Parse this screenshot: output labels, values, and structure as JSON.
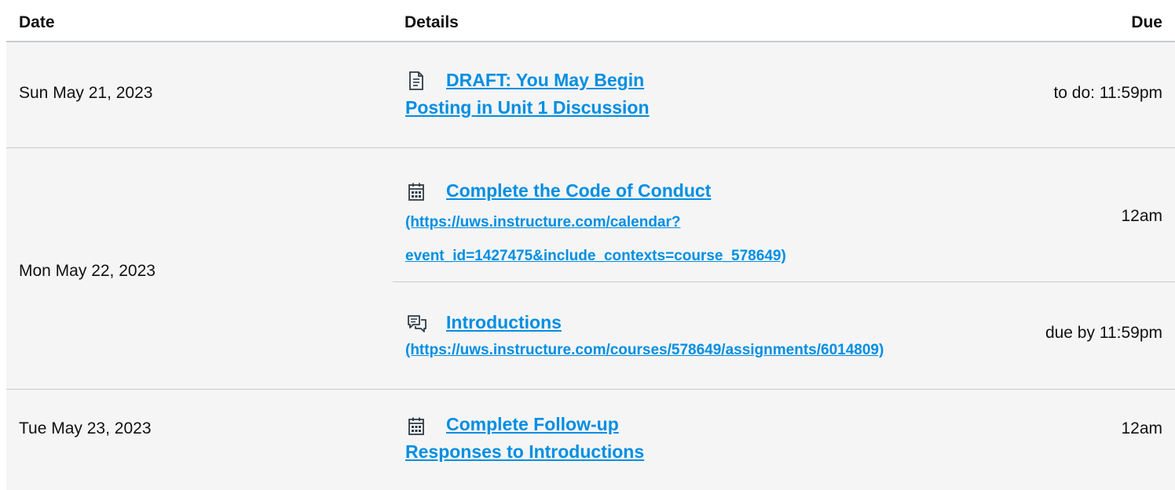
{
  "headers": {
    "date": "Date",
    "details": "Details",
    "due": "Due"
  },
  "rows": [
    {
      "date": "Sun May 21, 2023",
      "items": [
        {
          "icon": "document-icon",
          "title_line1": "DRAFT: You May Begin",
          "title_line2": "Posting in Unit 1 Discussion",
          "due": "to do: 11:59pm"
        }
      ]
    },
    {
      "date": "Mon May 22, 2023",
      "items": [
        {
          "icon": "calendar-icon",
          "title": "Complete the Code of Conduct",
          "url_line1": "(https://uws.instructure.com/calendar?",
          "url_line2": "event_id=1427475&include_contexts=course_578649)",
          "due": "12am"
        },
        {
          "icon": "discussion-icon",
          "title": "Introductions",
          "url_line1": "(https://uws.instructure.com/courses/578649/assignments/6014809)",
          "due": "due by 11:59pm"
        }
      ]
    },
    {
      "date": "Tue May 23, 2023",
      "items": [
        {
          "icon": "calendar-icon",
          "title_line1": "Complete Follow-up",
          "title_line2": "Responses to Introductions",
          "due": "12am"
        }
      ]
    }
  ],
  "colors": {
    "link": "#008ee2",
    "row_bg": "#f5f5f5",
    "border": "#c7cdd1"
  }
}
